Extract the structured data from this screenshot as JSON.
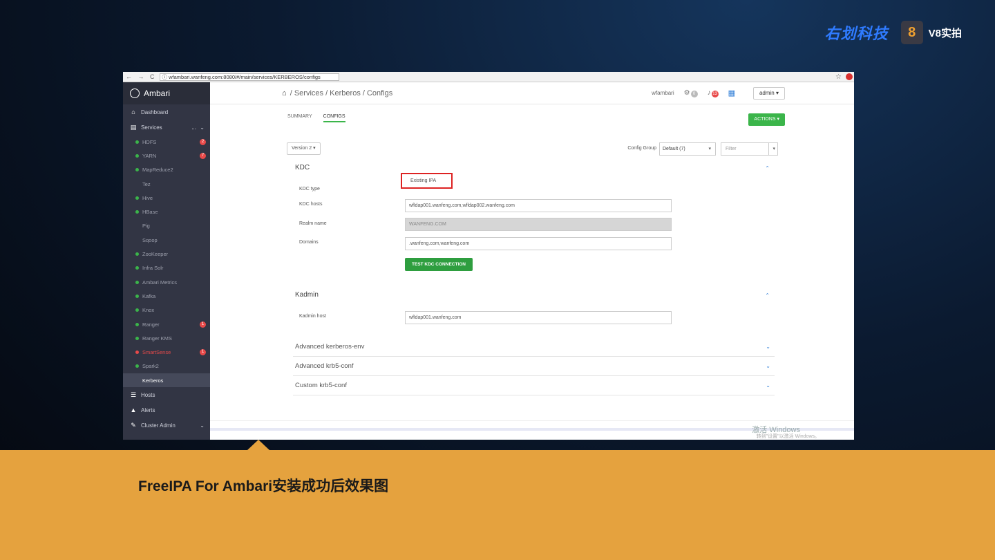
{
  "brand": {
    "logo_text": "右划科技",
    "v8_badge": "8",
    "v8_text": "V8实拍"
  },
  "browser": {
    "nav": "← → C",
    "url": "ⓘ wfambari.wanfeng.com:8080/#/main/services/KERBEROS/configs"
  },
  "sidebar": {
    "app_name": "Ambari",
    "dashboard": "Dashboard",
    "services": "Services",
    "services_more": "...",
    "services_list": [
      {
        "name": "HDFS",
        "status": "green",
        "badge": "2"
      },
      {
        "name": "YARN",
        "status": "green",
        "badge": "7"
      },
      {
        "name": "MapReduce2",
        "status": "green",
        "badge": ""
      },
      {
        "name": "Tez",
        "status": "none",
        "badge": ""
      },
      {
        "name": "Hive",
        "status": "green",
        "badge": ""
      },
      {
        "name": "HBase",
        "status": "green",
        "badge": ""
      },
      {
        "name": "Pig",
        "status": "none",
        "badge": ""
      },
      {
        "name": "Sqoop",
        "status": "none",
        "badge": ""
      },
      {
        "name": "ZooKeeper",
        "status": "green",
        "badge": ""
      },
      {
        "name": "Infra Solr",
        "status": "green",
        "badge": ""
      },
      {
        "name": "Ambari Metrics",
        "status": "green",
        "badge": ""
      },
      {
        "name": "Kafka",
        "status": "green",
        "badge": ""
      },
      {
        "name": "Knox",
        "status": "green",
        "badge": ""
      },
      {
        "name": "Ranger",
        "status": "green",
        "badge": "1"
      },
      {
        "name": "Ranger KMS",
        "status": "green",
        "badge": ""
      },
      {
        "name": "SmartSense",
        "status": "red",
        "badge": "1"
      },
      {
        "name": "Spark2",
        "status": "green",
        "badge": ""
      },
      {
        "name": "Kerberos",
        "status": "none",
        "badge": ""
      }
    ],
    "hosts": "Hosts",
    "alerts": "Alerts",
    "cluster_admin": "Cluster Admin"
  },
  "topbar": {
    "breadcrumb": "/ Services / Kerberos / Configs",
    "user_label": "wfambari",
    "ops_count": "0",
    "alerts_count": "13",
    "admin_label": "admin ▾"
  },
  "tabs": {
    "summary": "SUMMARY",
    "configs": "CONFIGS"
  },
  "toolbar": {
    "actions_label": "ACTIONS ▾",
    "version_label": "Version   2 ▾",
    "config_group_label": "Config Group",
    "config_group_value": "Default (7)",
    "filter_placeholder": "Filter"
  },
  "kdc": {
    "title": "KDC",
    "type_label": "KDC type",
    "type_value": "Existing IPA",
    "hosts_label": "KDC hosts",
    "hosts_value": "wfldap001.wanfeng.com,wfldap002.wanfeng.com",
    "realm_label": "Realm name",
    "realm_value": "WANFENG.COM",
    "domains_label": "Domains",
    "domains_value": ".wanfeng.com,wanfeng.com",
    "test_button": "TEST KDC CONNECTION"
  },
  "kadmin": {
    "title": "Kadmin",
    "host_label": "Kadmin host",
    "host_value": "wfldap001.wanfeng.com"
  },
  "advanced": [
    "Advanced kerberos-env",
    "Advanced krb5-conf",
    "Custom krb5-conf"
  ],
  "watermark": {
    "line1": "激活 Windows",
    "line2": "转到\"设置\"以激活 Windows。"
  },
  "caption": "FreeIPA For Ambari安装成功后效果图",
  "colors": {
    "accent_green": "#3bb54a",
    "caption_band": "#e5a23e",
    "sidebar_bg": "#323544",
    "alert_red": "#e84a4a",
    "link_blue": "#2b7bd6"
  }
}
